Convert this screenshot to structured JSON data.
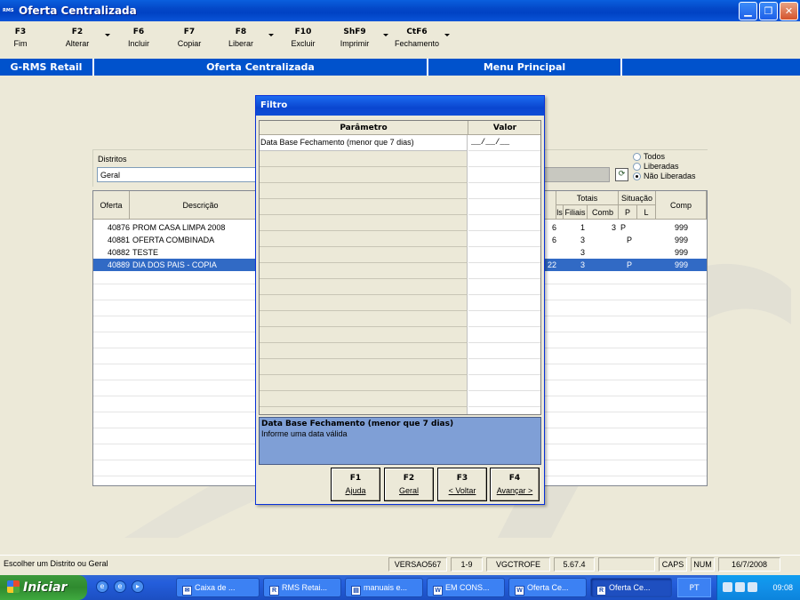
{
  "window": {
    "title": "Oferta Centralizada",
    "app_icon": "RMS"
  },
  "toolbar": {
    "buttons": [
      {
        "key": "F3",
        "label": "Fim"
      },
      {
        "key": "F2",
        "label": "Alterar"
      },
      {
        "key": "F6",
        "label": "Incluir"
      },
      {
        "key": "F7",
        "label": "Copiar"
      },
      {
        "key": "F8",
        "label": "Liberar"
      },
      {
        "key": "F10",
        "label": "Excluir"
      },
      {
        "key": "ShF9",
        "label": "Imprimir"
      },
      {
        "key": "CtF6",
        "label": "Fechamento"
      }
    ]
  },
  "header": {
    "app": "G-RMS Retail",
    "screen": "Oferta Centralizada",
    "menu": "Menu Principal"
  },
  "filter": {
    "distritos_label": "Distritos",
    "distrito_value": "Geral",
    "radios": [
      {
        "label": "Todos",
        "checked": false
      },
      {
        "label": "Liberadas",
        "checked": false
      },
      {
        "label": "Não Liberadas",
        "checked": true
      }
    ]
  },
  "grid": {
    "headers": {
      "oferta": "Oferta",
      "descricao": "Descrição",
      "totais": "Totais",
      "partial": "ls",
      "filiais": "Filiais",
      "comb": "Comb",
      "situacao": "Situação",
      "p": "P",
      "l": "L",
      "comp": "Comp"
    },
    "rows": [
      {
        "oferta": "40876",
        "descricao": "PROM CASA LIMPA 2008",
        "ls": "6",
        "filiais": "1",
        "comb": "3",
        "p": "P",
        "l": "",
        "comp": "999",
        "selected": false
      },
      {
        "oferta": "40881",
        "descricao": "OFERTA COMBINADA",
        "ls": "6",
        "filiais": "3",
        "comb": "",
        "p": "P",
        "l": "",
        "comp": "999",
        "selected": false
      },
      {
        "oferta": "40882",
        "descricao": "TESTE",
        "ls": "",
        "filiais": "3",
        "comb": "",
        "p": "",
        "l": "",
        "comp": "999",
        "selected": false
      },
      {
        "oferta": "40889",
        "descricao": "DIA DOS PAIS - COPIA",
        "ls": "22",
        "filiais": "3",
        "comb": "",
        "p": "P",
        "l": "",
        "comp": "999",
        "selected": true
      }
    ]
  },
  "dialog": {
    "title": "Filtro",
    "col_param": "Parâmetro",
    "col_value": "Valor",
    "param_name": "Data Base Fechamento (menor que 7 dias)",
    "param_value": "__/__/__",
    "help_title": "Data Base Fechamento (menor que 7 dias)",
    "help_text": "Informe uma data válida",
    "buttons": [
      {
        "key": "F1",
        "label": "Ajuda"
      },
      {
        "key": "F2",
        "label": "Geral"
      },
      {
        "key": "F3",
        "label": "< Voltar"
      },
      {
        "key": "F4",
        "label": "Avançar >"
      }
    ]
  },
  "statusbar": {
    "message": "Escolher um Distrito ou Geral",
    "version": "VERSAO567",
    "page": "1-9",
    "module": "VGCTROFE",
    "build": "5.67.4",
    "caps": "CAPS",
    "num": "NUM",
    "date": "16/7/2008"
  },
  "taskbar": {
    "start": "Iniciar",
    "tasks": [
      {
        "label": "Caixa de ...",
        "icon": "mail-icon"
      },
      {
        "label": "RMS Retai...",
        "icon": "rms-icon"
      },
      {
        "label": "manuais e...",
        "icon": "folder-icon"
      },
      {
        "label": "EM CONS...",
        "icon": "word-icon"
      },
      {
        "label": "Oferta Ce...",
        "icon": "word-icon"
      },
      {
        "label": "Oferta Ce...",
        "icon": "rms-icon"
      }
    ],
    "lang": "PT",
    "time": "09:08"
  },
  "colors": {
    "header_blue": "#0052CC",
    "selection": "#316AC5",
    "help_bg": "#7F9FD6"
  }
}
